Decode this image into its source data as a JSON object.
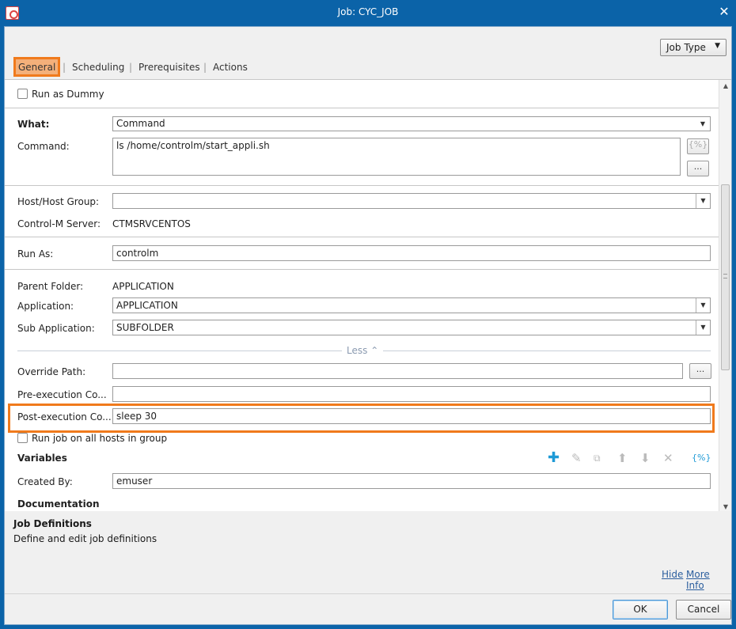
{
  "window": {
    "title": "Job: CYC_JOB"
  },
  "header": {
    "job_type_label": "Job Type",
    "tabs": [
      {
        "label": "General",
        "active": true
      },
      {
        "label": "Scheduling"
      },
      {
        "label": "Prerequisites"
      },
      {
        "label": "Actions"
      }
    ],
    "tab_separator": "|"
  },
  "general": {
    "run_as_dummy": {
      "label": "Run as Dummy",
      "checked": false
    },
    "what": {
      "label": "What:",
      "value": "Command"
    },
    "command": {
      "label": "Command:",
      "value": "ls /home/controlm/start_appli.sh",
      "vars_button": "{%}",
      "more_button": "..."
    },
    "host_group": {
      "label": "Host/Host Group:",
      "value": ""
    },
    "server": {
      "label": "Control-M Server:",
      "value": "CTMSRVCENTOS"
    },
    "run_as": {
      "label": "Run As:",
      "value": "controlm"
    },
    "parent_folder": {
      "label": "Parent Folder:",
      "value": "APPLICATION"
    },
    "application": {
      "label": "Application:",
      "value": "APPLICATION"
    },
    "sub_application": {
      "label": "Sub Application:",
      "value": "SUBFOLDER"
    },
    "less_label": "Less",
    "override_path": {
      "label": "Override Path:",
      "value": "",
      "more_button": "..."
    },
    "pre_exec": {
      "label": "Pre-execution Co...",
      "value": ""
    },
    "post_exec": {
      "label": "Post-execution Co...",
      "value": "sleep 30"
    },
    "run_on_all_hosts": {
      "label": "Run job on all hosts in group",
      "checked": false
    },
    "variables": {
      "label": "Variables",
      "vars_button": "{%}"
    },
    "created_by": {
      "label": "Created By:",
      "value": "emuser"
    },
    "documentation": {
      "label": "Documentation"
    }
  },
  "help": {
    "title": "Job Definitions",
    "description": "Define and edit job definitions",
    "hide_link": "Hide",
    "more_info_link": "More Info"
  },
  "footer": {
    "ok_label": "OK",
    "cancel_label": "Cancel"
  },
  "colors": {
    "titlebar": "#0b63a8",
    "highlight": "#f07a1c",
    "tab_active_bg": "#f4b07a",
    "add_icon": "#1e9ad6"
  },
  "icons": {
    "add": "plus-icon",
    "edit": "pencil-icon",
    "copy": "copy-icon",
    "up": "arrow-up-icon",
    "down": "arrow-down-icon",
    "delete": "delete-icon"
  }
}
